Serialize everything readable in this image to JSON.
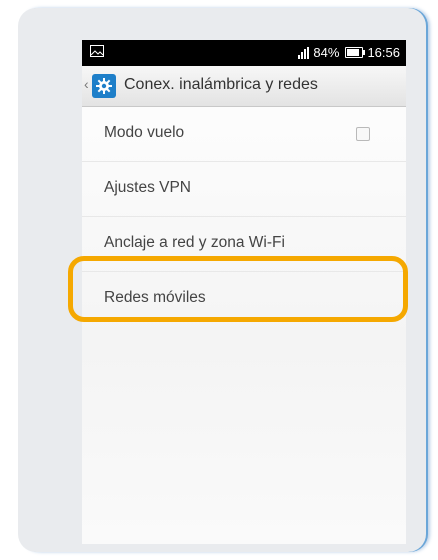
{
  "statusbar": {
    "left_icon": "image-icon",
    "battery_percent": "84%",
    "time": "16:56",
    "signal_icon": "signal-bars-icon",
    "battery_icon": "battery-icon"
  },
  "actionbar": {
    "icon": "settings-gear-icon",
    "title": "Conex. inalámbrica y redes"
  },
  "settings": {
    "items": [
      {
        "label": "Modo vuelo",
        "has_checkbox": true,
        "checked": false
      },
      {
        "label": "Ajustes VPN"
      },
      {
        "label": "Anclaje a red y zona Wi-Fi"
      },
      {
        "label": "Redes móviles",
        "highlighted": true
      }
    ]
  },
  "colors": {
    "highlight": "#f5a800",
    "gear_tile": "#1e7fc9",
    "statusbar": "#000000"
  }
}
